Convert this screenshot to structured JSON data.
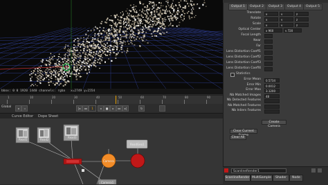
{
  "viewer": {
    "info_left": "bbox: 0 0 1920 1440 channels: rgba",
    "info_right": "x=2749 y=1554"
  },
  "timeline": {
    "labels": [
      "1",
      "10",
      "20",
      "30",
      "40",
      "50",
      "60",
      "70",
      "80",
      "90"
    ],
    "frame": "1",
    "left_label": "Global"
  },
  "bottom_tabs": [
    "Curve Editor",
    "Dope Sheet"
  ],
  "nodes": {
    "read1": "Read1",
    "read2": "Read2",
    "read3": "Read3",
    "camera": "Camera",
    "pointcloud": "PointCloud",
    "readgeo": "ReadGeo1",
    "render": "ScanlineRender",
    "bottom": "Camera1"
  },
  "props": {
    "tabs": [
      "Output 1",
      "Output 2",
      "Output 3",
      "Output 4",
      "Output 5"
    ],
    "rows": [
      {
        "label": "Translate",
        "values": [
          "x  ",
          "y  ",
          "z  "
        ]
      },
      {
        "label": "Rotate",
        "values": [
          "x  ",
          "y  ",
          "z  "
        ]
      },
      {
        "label": "Scale",
        "values": [
          "x  ",
          "y  ",
          "z  "
        ]
      },
      {
        "label": "Optical Center",
        "values": [
          "x  960",
          "y  720"
        ]
      },
      {
        "label": "Focal Length",
        "values": [
          ""
        ]
      },
      {
        "label": "Near",
        "values": [
          ""
        ]
      },
      {
        "label": "Far",
        "values": [
          ""
        ]
      },
      {
        "label": "Lens Distortion Coeff1",
        "values": [
          ""
        ]
      },
      {
        "label": "Lens Distortion Coeff2",
        "values": [
          ""
        ]
      },
      {
        "label": "Lens Distortion Coeff3",
        "values": [
          ""
        ]
      },
      {
        "label": "Lens Distortion Coeff4",
        "values": [
          ""
        ]
      }
    ],
    "statistics_label": "Statistics",
    "stats": [
      {
        "label": "Error Mean",
        "value": "0.5734"
      },
      {
        "label": "Error Min",
        "value": "0.0012"
      },
      {
        "label": "Error Max",
        "value": "3.1200"
      },
      {
        "label": "Nb Matched Images",
        "value": "48"
      },
      {
        "label": "Nb Detected Features",
        "value": ""
      },
      {
        "label": "Nb Matched Features",
        "value": ""
      },
      {
        "label": "Nb Inliers Features",
        "value": ""
      }
    ],
    "create_camera": "Create Camera",
    "clear_current_frame": "Clear Current Frame",
    "clear_all": "Clear All"
  },
  "scan": {
    "title": "ScanlineRender1",
    "tabs": [
      "ScanlineRender",
      "MultiSample",
      "Shader",
      "Node"
    ]
  }
}
